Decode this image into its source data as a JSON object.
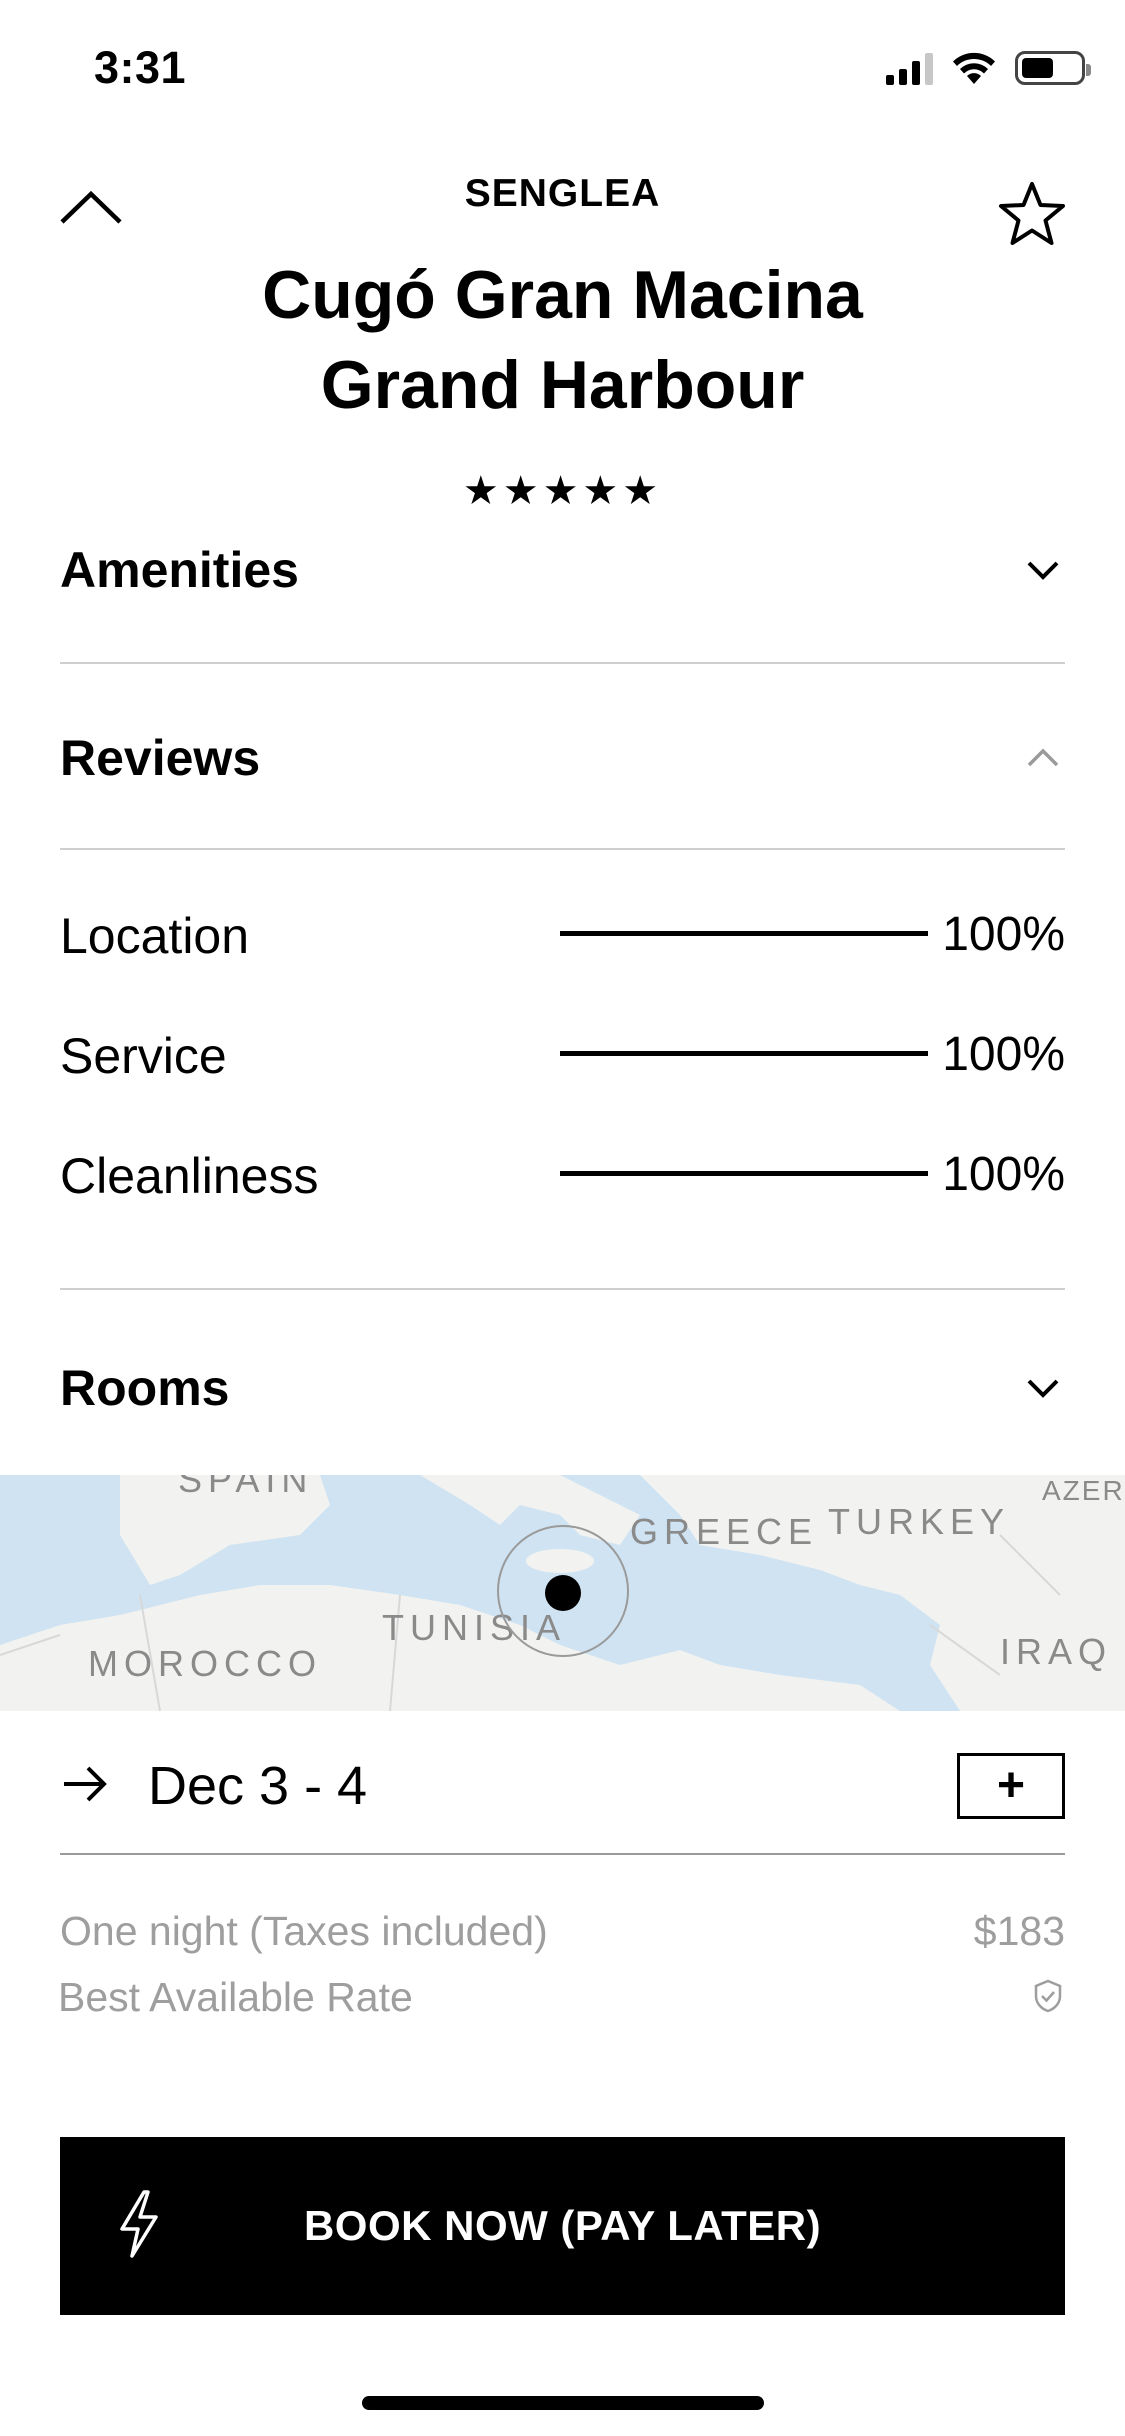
{
  "status_bar": {
    "time": "3:31",
    "battery_percent": 55
  },
  "header": {
    "location": "SENGLEA",
    "hotel_name_line1": "Cugó Gran Macina",
    "hotel_name_line2": "Grand Harbour",
    "stars": "★★★★★",
    "star_count": 5,
    "icons": {
      "collapse": "chevron-up-icon",
      "favorite": "star-outline-icon"
    }
  },
  "sections": {
    "amenities": {
      "label": "Amenities",
      "expanded": false
    },
    "reviews": {
      "label": "Reviews",
      "expanded": true
    },
    "rooms": {
      "label": "Rooms",
      "expanded": false
    }
  },
  "reviews": [
    {
      "label": "Location",
      "percent": 100,
      "value": "100%"
    },
    {
      "label": "Service",
      "percent": 100,
      "value": "100%"
    },
    {
      "label": "Cleanliness",
      "percent": 100,
      "value": "100%"
    }
  ],
  "map": {
    "labels": {
      "spain": "SPAIN",
      "greece": "GREECE",
      "turkey": "TURKEY",
      "azer": "AZERB",
      "tunisia": "TUNISIA",
      "morocco": "MOROCCO",
      "iraq": "IRAQ"
    }
  },
  "booking": {
    "dates": "Dec 3 - 4",
    "add_label": "+",
    "price_label": "One night (Taxes included)",
    "price_value": "$183",
    "rate_label": "Best Available Rate",
    "book_label": "BOOK NOW (PAY LATER)"
  },
  "colors": {
    "accent": "#000000",
    "muted_text": "#9e9e9e",
    "map_water": "#cfe3f2",
    "map_land": "#f2f2f0"
  }
}
